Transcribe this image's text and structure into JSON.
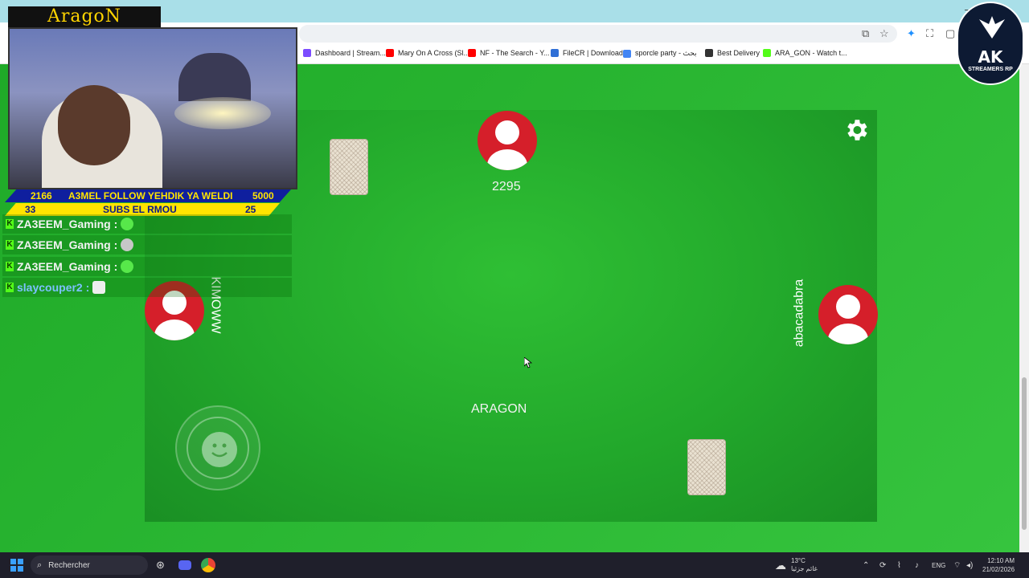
{
  "browser": {
    "new_tab": "+",
    "minimize": "–",
    "bookmarks": [
      {
        "label": "Dashboard | Stream...",
        "color": "#7b4cff"
      },
      {
        "label": "Mary On A Cross (Sl...",
        "color": "#ff0000"
      },
      {
        "label": "NF - The Search - Y...",
        "color": "#ff0000"
      },
      {
        "label": "FileCR | Download",
        "color": "#2f6fd6"
      },
      {
        "label": "sporcle party - بحث",
        "color": "#4285f4"
      },
      {
        "label": "Best Delivery",
        "color": "#333333"
      },
      {
        "label": "ARA_GON - Watch t...",
        "color": "#53fc18"
      }
    ]
  },
  "game": {
    "players": {
      "top": {
        "name": "2295"
      },
      "left": {
        "name": "KIMOWW"
      },
      "right": {
        "name": "abacadabra"
      },
      "bottom": {
        "name": "ARAGON"
      }
    },
    "settings_icon": "gear-icon",
    "emoji_icon": "smiley-icon",
    "table_color": "#22a82b",
    "avatar_color": "#d51f2a"
  },
  "stream_overlay": {
    "brand": "AragoN",
    "banner_top": {
      "left_num": "2166",
      "text": "A3MEL FOLLOW YEHDIK YA WELDI",
      "right_num": "5000"
    },
    "banner_bottom": {
      "left_num": "33",
      "text": "SUBS EL RMOU",
      "right_num": "25"
    },
    "chat": [
      {
        "user": "ZA3EEM_Gaming :"
      },
      {
        "user": "ZA3EEM_Gaming :"
      },
      {
        "user": "ZA3EEM_Gaming :"
      },
      {
        "user": "slaycouper2 :"
      }
    ],
    "logo": {
      "main": "AK",
      "sub": "STREAMERS RP"
    }
  },
  "taskbar": {
    "search": "Rechercher",
    "weather_temp": "13°C",
    "weather_text": "غائم جزئيا",
    "lang": "ENG",
    "time": "12:10 AM",
    "date": "21/02/2026"
  }
}
